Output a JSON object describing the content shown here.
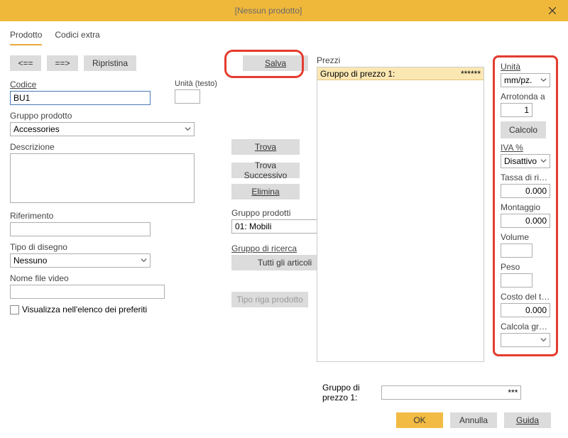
{
  "window": {
    "title": "[Nessun prodotto]"
  },
  "tabs": {
    "product": "Prodotto",
    "extra": "Codici extra"
  },
  "nav": {
    "prev": "<==",
    "next": "==>",
    "reset": "Ripristina",
    "save": "Salva"
  },
  "fields": {
    "code_label": "Codice",
    "code_value": "BU1",
    "unit_text_label": "Unità (testo)",
    "unit_text_value": "",
    "group_label": "Gruppo prodotto",
    "group_value": "Accessories",
    "descr_label": "Descrizione",
    "descr_value": "",
    "ref_label": "Riferimento",
    "ref_value": "",
    "prod_group_label": "Gruppo prodotti",
    "prod_group_value": "01: Mobili",
    "dwg_type_label": "Tipo di disegno",
    "dwg_type_value": "Nessuno",
    "search_group_label": "Gruppo di ricerca",
    "search_group_btn": "Tutti gli articoli",
    "video_label": "Nome file video",
    "video_value": "",
    "fav_label": "Visualizza nell'elenco dei preferiti",
    "row_type_btn": "Tipo riga prodotto"
  },
  "mid_buttons": {
    "find": "Trova",
    "find_next": "Trova Successivo",
    "delete": "Elimina"
  },
  "prices": {
    "label": "Prezzi",
    "row_label": "Gruppo di prezzo   1:",
    "row_value": "******"
  },
  "footer_group": {
    "label": "Gruppo di prezzo   1:",
    "value": "***"
  },
  "right": {
    "unit_label": "Unità",
    "unit_value": "mm/pz.",
    "round_label": "Arrotonda a",
    "round_value": "1",
    "calc_btn": "Calcolo",
    "vat_label": "IVA %",
    "vat_value": "Disattivo",
    "recycle_label": "Tassa di ricic…",
    "recycle_value": "0.000",
    "assembly_label": "Montaggio",
    "assembly_value": "0.000",
    "volume_label": "Volume",
    "volume_value": "",
    "weight_label": "Peso",
    "weight_value": "",
    "transport_label": "Costo del tra…",
    "transport_value": "0.000",
    "calc_group_label": "Calcola gruppo",
    "calc_group_value": ""
  },
  "footer": {
    "ok": "OK",
    "cancel": "Annulla",
    "help": "Guida"
  }
}
